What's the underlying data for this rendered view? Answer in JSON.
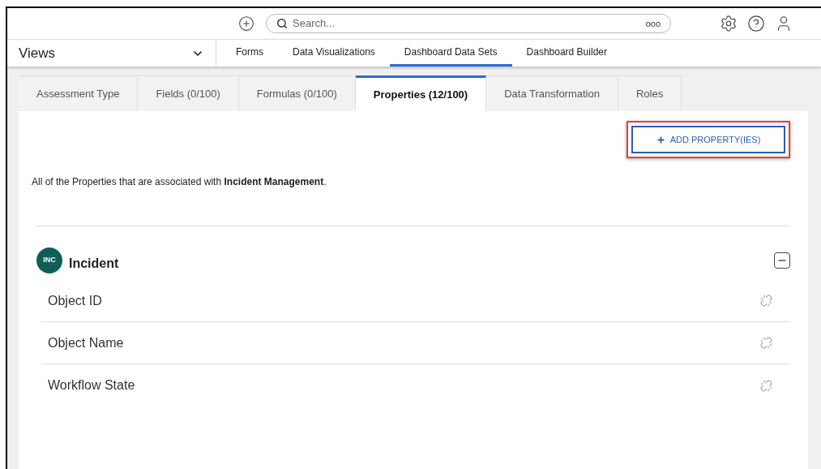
{
  "top_bar": {
    "search": {
      "placeholder": "Search..."
    },
    "search_options": "ooo"
  },
  "nav": {
    "views_label": "Views",
    "links": [
      {
        "label": "Forms",
        "selected": false
      },
      {
        "label": "Data Visualizations",
        "selected": false
      },
      {
        "label": "Dashboard Data Sets",
        "selected": true
      },
      {
        "label": "Dashboard Builder",
        "selected": false
      }
    ]
  },
  "tabs": [
    {
      "label": "Assessment Type",
      "selected": false
    },
    {
      "label": "Fields (0/100)",
      "selected": false
    },
    {
      "label": "Formulas (0/100)",
      "selected": false
    },
    {
      "label": "Properties (12/100)",
      "selected": true
    },
    {
      "label": "Data Transformation",
      "selected": false
    },
    {
      "label": "Roles",
      "selected": false
    }
  ],
  "add_button": {
    "label": "ADD PROPERTY(IES)",
    "highlighted": true
  },
  "description": "All of the Properties that are associated with **Incident Management**.",
  "section": {
    "badge": "INC",
    "title": "Incident",
    "expanded": true,
    "items": [
      {
        "label": "Object ID"
      },
      {
        "label": "Object Name"
      },
      {
        "label": "Workflow State"
      }
    ]
  }
}
